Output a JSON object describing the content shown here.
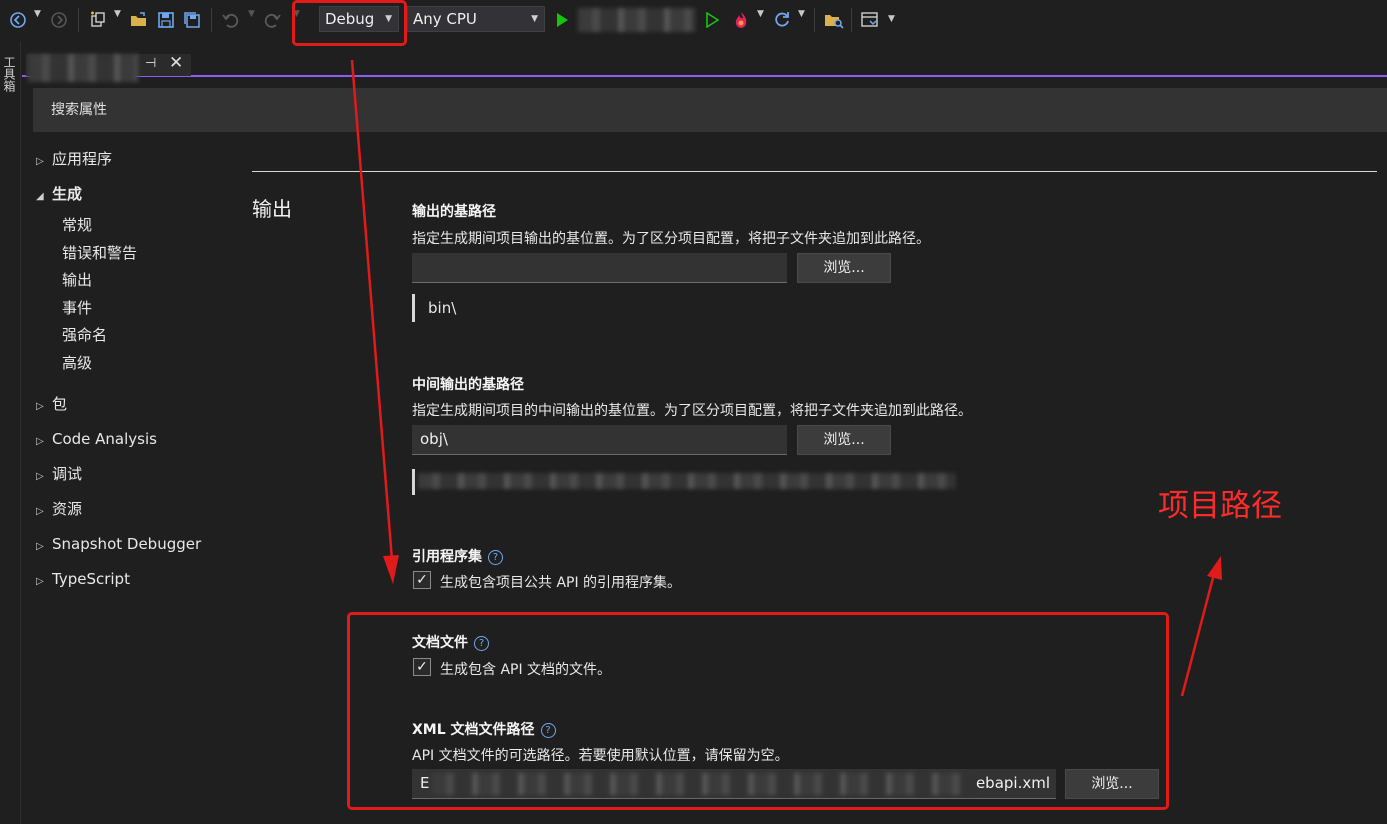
{
  "toolbar": {
    "configuration": "Debug",
    "platform": "Any CPU"
  },
  "left_rail": {
    "label": "工具箱"
  },
  "search": {
    "placeholder": "搜索属性"
  },
  "nav": {
    "items": [
      {
        "label": "应用程序",
        "expanded": false
      },
      {
        "label": "生成",
        "expanded": true
      },
      {
        "label": "包",
        "expanded": false
      },
      {
        "label": "Code Analysis",
        "expanded": false
      },
      {
        "label": "调试",
        "expanded": false
      },
      {
        "label": "资源",
        "expanded": false
      },
      {
        "label": "Snapshot Debugger",
        "expanded": false
      },
      {
        "label": "TypeScript",
        "expanded": false
      }
    ],
    "build_children": [
      "常规",
      "错误和警告",
      "输出",
      "事件",
      "强命名",
      "高级"
    ]
  },
  "section": {
    "title": "输出"
  },
  "base_output": {
    "label": "输出的基路径",
    "desc": "指定生成期间项目输出的基位置。为了区分项目配置，将把子文件夹追加到此路径。",
    "value": "",
    "browse": "浏览...",
    "preview": "bin\\"
  },
  "intermediate_output": {
    "label": "中间输出的基路径",
    "desc": "指定生成期间项目的中间输出的基位置。为了区分项目配置，将把子文件夹追加到此路径。",
    "value": "obj\\",
    "browse": "浏览..."
  },
  "reference_assembly": {
    "label": "引用程序集",
    "checkbox_label": "生成包含项目公共 API 的引用程序集。",
    "checked": true
  },
  "doc_file": {
    "label": "文档文件",
    "checkbox_label": "生成包含 API 文档的文件。",
    "checked": true
  },
  "xml_doc_path": {
    "label": "XML 文档文件路径",
    "desc": "API 文档文件的可选路径。若要使用默认位置，请保留为空。",
    "value_start": "E",
    "value_end": "ebapi.xml",
    "browse": "浏览..."
  },
  "annotation": {
    "text": "项目路径",
    "color": "#ff2a2a"
  },
  "colors": {
    "accent": "#8b5cf6",
    "run": "#16c60c",
    "annotation_red": "#e11a1a"
  }
}
